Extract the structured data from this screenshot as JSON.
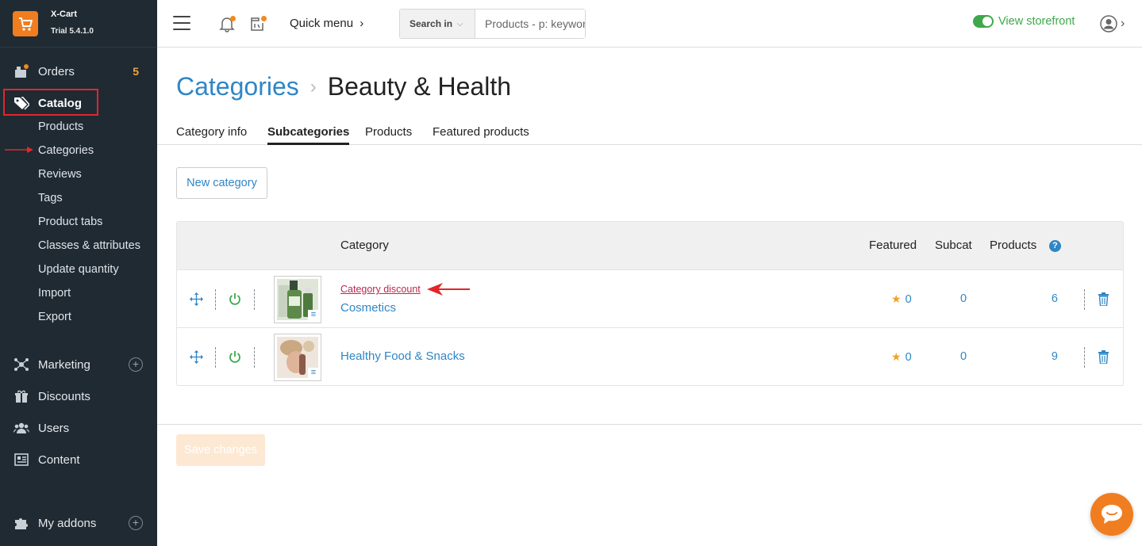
{
  "brand": {
    "name": "X-Cart",
    "version": "Trial 5.4.1.0"
  },
  "sidebar": {
    "orders": {
      "label": "Orders",
      "count": "5"
    },
    "catalog": {
      "label": "Catalog"
    },
    "catalog_items": [
      "Products",
      "Categories",
      "Reviews",
      "Tags",
      "Product tabs",
      "Classes & attributes",
      "Update quantity",
      "Import",
      "Export"
    ],
    "marketing": {
      "label": "Marketing"
    },
    "discounts": {
      "label": "Discounts"
    },
    "users": {
      "label": "Users"
    },
    "content": {
      "label": "Content"
    },
    "addons": {
      "label": "My addons"
    }
  },
  "header": {
    "quick_menu": "Quick menu",
    "search_in": "Search in",
    "search_placeholder": "Products - p: keyword",
    "view_storefront": "View storefront"
  },
  "page": {
    "breadcrumb_parent": "Categories",
    "breadcrumb_current": "Beauty & Health",
    "tabs": [
      "Category info",
      "Subcategories",
      "Products",
      "Featured products"
    ],
    "active_tab": "Subcategories",
    "new_category": "New category",
    "save_changes": "Save changes"
  },
  "table": {
    "columns": {
      "category": "Category",
      "featured": "Featured",
      "subcat": "Subcat",
      "products": "Products",
      "help": "?"
    },
    "rows": [
      {
        "discount_link": "Category discount",
        "name": "Cosmetics",
        "featured": "0",
        "subcat": "0",
        "products": "6"
      },
      {
        "name": "Healthy Food & Snacks",
        "featured": "0",
        "subcat": "0",
        "products": "9"
      }
    ]
  },
  "colors": {
    "accent": "#2f86c6",
    "brand": "#f07d1f",
    "sidebar": "#1f2a33",
    "success": "#3ea84a",
    "highlight": "#e3262a"
  }
}
